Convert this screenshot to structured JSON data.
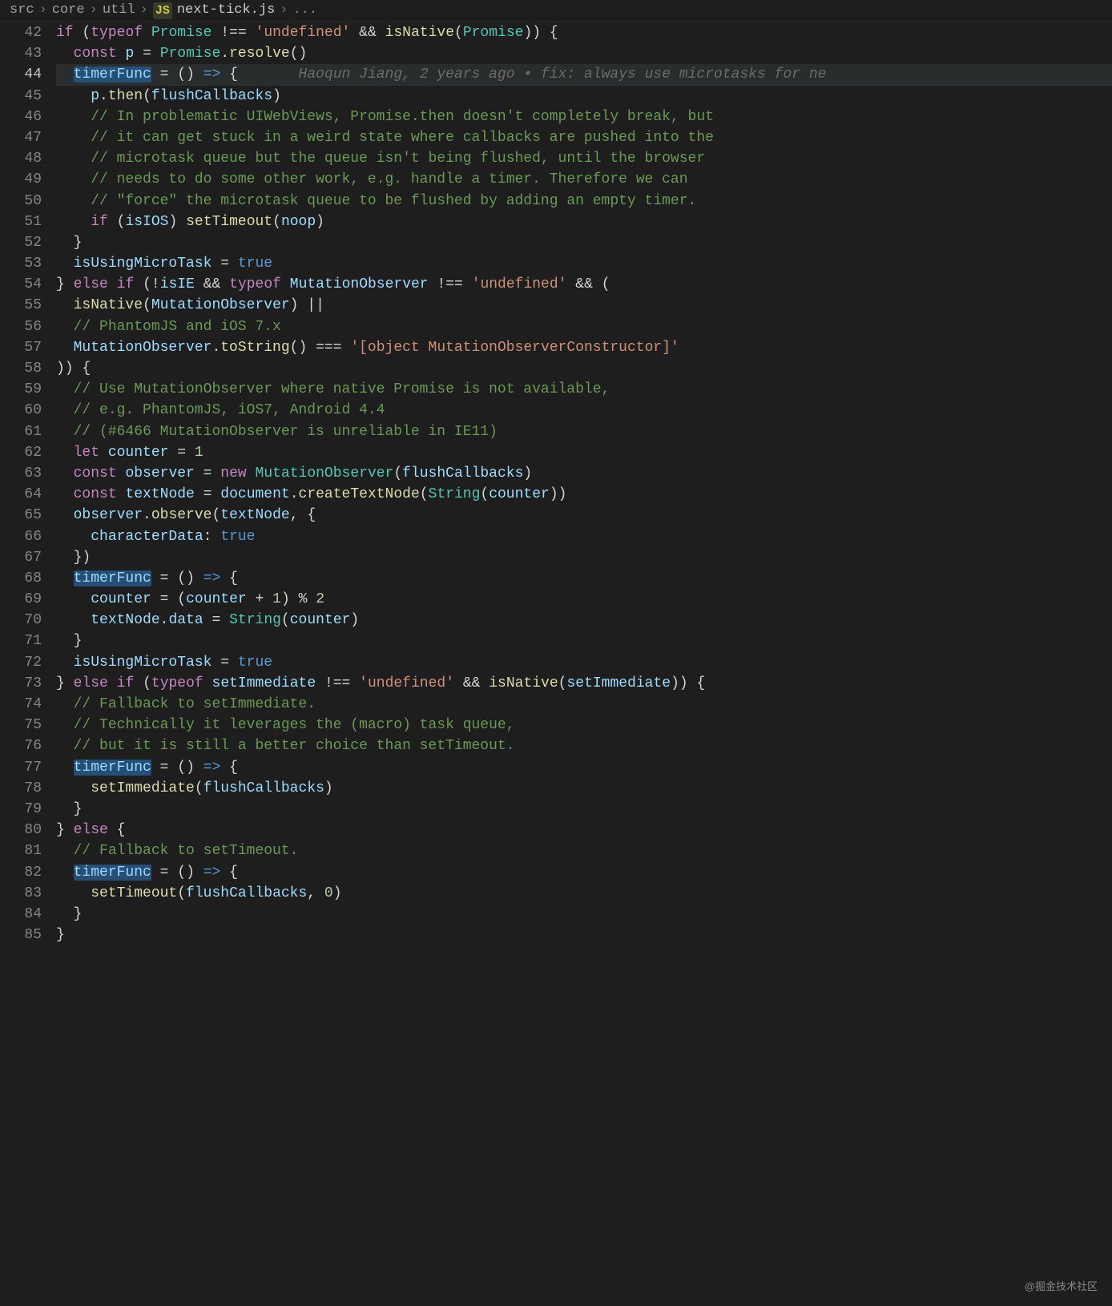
{
  "breadcrumb": {
    "parts": [
      "src",
      "core",
      "util"
    ],
    "fileIcon": "JS",
    "file": "next-tick.js",
    "trailing": "..."
  },
  "gutter": {
    "start": 42,
    "end": 85,
    "active": 44
  },
  "blame": {
    "author": "Haoqun Jiang",
    "age": "2 years ago",
    "sep": "•",
    "msg": "fix: always use microtasks for ne"
  },
  "watermark": "@掘金技术社区",
  "code": {
    "l42": {
      "kw_if": "if",
      "paren1": "(",
      "kw_typeof": "typeof",
      "sp": " ",
      "id_promise": "Promise",
      "sp2": " ",
      "op_neq": "!==",
      "sp3": " ",
      "str_undef": "'undefined'",
      "sp4": " ",
      "op_and": "&&",
      "sp5": " ",
      "fn_isnative": "isNative",
      "paren2": "(",
      "id_promise2": "Promise",
      "paren3": ")",
      ")_": ")",
      "sp6": " ",
      "brace": "{"
    },
    "l43": {
      "kw_const": "const",
      "sp": " ",
      "id_p": "p",
      "sp2": " ",
      "eq": "=",
      "sp3": " ",
      "id_promise": "Promise",
      "dot": ".",
      "fn_resolve": "resolve",
      "parens": "()"
    },
    "l44": {
      "id_timerfunc": "timerFunc",
      "sp": " ",
      "eq": "=",
      "sp2": " ",
      "parens": "()",
      "sp3": " ",
      "arrow": "=>",
      "sp4": " ",
      "brace": "{"
    },
    "l45": {
      "id_p": "p",
      "dot": ".",
      "fn_then": "then",
      "paren1": "(",
      "id_flush": "flushCallbacks",
      "paren2": ")"
    },
    "l46": {
      "cmt": "// In problematic UIWebViews, Promise.then doesn't completely break, but"
    },
    "l47": {
      "cmt": "// it can get stuck in a weird state where callbacks are pushed into the"
    },
    "l48": {
      "cmt": "// microtask queue but the queue isn't being flushed, until the browser"
    },
    "l49": {
      "cmt": "// needs to do some other work, e.g. handle a timer. Therefore we can"
    },
    "l50": {
      "cmt": "// \"force\" the microtask queue to be flushed by adding an empty timer."
    },
    "l51": {
      "kw_if": "if",
      "sp": " ",
      "paren1": "(",
      "id_isios": "isIOS",
      "paren2": ")",
      "sp2": " ",
      "fn_settimeout": "setTimeout",
      "paren3": "(",
      "id_noop": "noop",
      "paren4": ")"
    },
    "l52": {
      "brace": "}"
    },
    "l53": {
      "id_isusing": "isUsingMicroTask",
      "sp": " ",
      "eq": "=",
      "sp2": " ",
      "bool": "true"
    },
    "l54": {
      "brace": "}",
      "sp": " ",
      "kw_else": "else",
      "sp2": " ",
      "kw_if": "if",
      "sp3": " ",
      "paren1": "(",
      "excl": "!",
      "id_isie": "isIE",
      "sp4": " ",
      "op_and": "&&",
      "sp5": " ",
      "kw_typeof": "typeof",
      "sp6": " ",
      "id_mo": "MutationObserver",
      "sp7": " ",
      "op_neq": "!==",
      "sp8": " ",
      "str_undef": "'undefined'",
      "sp9": " ",
      "op_and2": "&&",
      "sp10": " ",
      "paren2": "("
    },
    "l55": {
      "fn_isnative": "isNative",
      "paren1": "(",
      "id_mo": "MutationObserver",
      "paren2": ")",
      "sp": " ",
      "op_or": "||"
    },
    "l56": {
      "cmt": "// PhantomJS and iOS 7.x"
    },
    "l57": {
      "id_mo": "MutationObserver",
      "dot": ".",
      "fn_tostring": "toString",
      "parens": "()",
      "sp": " ",
      "op_eq": "===",
      "sp2": " ",
      "str": "'[object MutationObserverConstructor]'"
    },
    "l58": {
      "parens": "))",
      "sp": " ",
      "brace": "{"
    },
    "l59": {
      "cmt": "// Use MutationObserver where native Promise is not available,"
    },
    "l60": {
      "cmt": "// e.g. PhantomJS, iOS7, Android 4.4"
    },
    "l61": {
      "cmt": "// (#6466 MutationObserver is unreliable in IE11)"
    },
    "l62": {
      "kw_let": "let",
      "sp": " ",
      "id_counter": "counter",
      "sp2": " ",
      "eq": "=",
      "sp3": " ",
      "num": "1"
    },
    "l63": {
      "kw_const": "const",
      "sp": " ",
      "id_observer": "observer",
      "sp2": " ",
      "eq": "=",
      "sp3": " ",
      "kw_new": "new",
      "sp4": " ",
      "type_mo": "MutationObserver",
      "paren1": "(",
      "id_flush": "flushCallbacks",
      "paren2": ")"
    },
    "l64": {
      "kw_const": "const",
      "sp": " ",
      "id_textnode": "textNode",
      "sp2": " ",
      "eq": "=",
      "sp3": " ",
      "id_document": "document",
      "dot": ".",
      "fn_ctn": "createTextNode",
      "paren1": "(",
      "type_string": "String",
      "paren2": "(",
      "id_counter": "counter",
      "paren3": ")",
      "paren4": ")"
    },
    "l65": {
      "id_observer": "observer",
      "dot": ".",
      "fn_observe": "observe",
      "paren1": "(",
      "id_textnode": "textNode",
      "comma": ",",
      "sp": " ",
      "brace": "{"
    },
    "l66": {
      "id_chardata": "characterData",
      "colon": ":",
      "sp": " ",
      "bool": "true"
    },
    "l67": {
      "brace": "}",
      "paren": ")"
    },
    "l68": {
      "id_timerfunc": "timerFunc",
      "sp": " ",
      "eq": "=",
      "sp2": " ",
      "parens": "()",
      "sp3": " ",
      "arrow": "=>",
      "sp4": " ",
      "brace": "{"
    },
    "l69": {
      "id_counter": "counter",
      "sp": " ",
      "eq": "=",
      "sp2": " ",
      "paren1": "(",
      "id_counter2": "counter",
      "sp3": " ",
      "plus": "+",
      "sp4": " ",
      "num1": "1",
      "paren2": ")",
      "sp5": " ",
      "mod": "%",
      "sp6": " ",
      "num2": "2"
    },
    "l70": {
      "id_textnode": "textNode",
      "dot": ".",
      "id_data": "data",
      "sp": " ",
      "eq": "=",
      "sp2": " ",
      "type_string": "String",
      "paren1": "(",
      "id_counter": "counter",
      "paren2": ")"
    },
    "l71": {
      "brace": "}"
    },
    "l72": {
      "id_isusing": "isUsingMicroTask",
      "sp": " ",
      "eq": "=",
      "sp2": " ",
      "bool": "true"
    },
    "l73": {
      "brace": "}",
      "sp": " ",
      "kw_else": "else",
      "sp2": " ",
      "kw_if": "if",
      "sp3": " ",
      "paren1": "(",
      "kw_typeof": "typeof",
      "sp4": " ",
      "id_setimm": "setImmediate",
      "sp5": " ",
      "op_neq": "!==",
      "sp6": " ",
      "str_undef": "'undefined'",
      "sp7": " ",
      "op_and": "&&",
      "sp8": " ",
      "fn_isnative": "isNative",
      "paren2": "(",
      "id_setimm2": "setImmediate",
      "paren3": ")",
      "paren4": ")",
      "sp9": " ",
      "brace2": "{"
    },
    "l74": {
      "cmt": "// Fallback to setImmediate."
    },
    "l75": {
      "cmt": "// Technically it leverages the (macro) task queue,"
    },
    "l76": {
      "cmt": "// but it is still a better choice than setTimeout."
    },
    "l77": {
      "id_timerfunc": "timerFunc",
      "sp": " ",
      "eq": "=",
      "sp2": " ",
      "parens": "()",
      "sp3": " ",
      "arrow": "=>",
      "sp4": " ",
      "brace": "{"
    },
    "l78": {
      "fn_setimm": "setImmediate",
      "paren1": "(",
      "id_flush": "flushCallbacks",
      "paren2": ")"
    },
    "l79": {
      "brace": "}"
    },
    "l80": {
      "brace": "}",
      "sp": " ",
      "kw_else": "else",
      "sp2": " ",
      "brace2": "{"
    },
    "l81": {
      "cmt": "// Fallback to setTimeout."
    },
    "l82": {
      "id_timerfunc": "timerFunc",
      "sp": " ",
      "eq": "=",
      "sp2": " ",
      "parens": "()",
      "sp3": " ",
      "arrow": "=>",
      "sp4": " ",
      "brace": "{"
    },
    "l83": {
      "fn_settimeout": "setTimeout",
      "paren1": "(",
      "id_flush": "flushCallbacks",
      "comma": ",",
      "sp": " ",
      "num": "0",
      "paren2": ")"
    },
    "l84": {
      "brace": "}"
    },
    "l85": {
      "brace": "}"
    }
  }
}
